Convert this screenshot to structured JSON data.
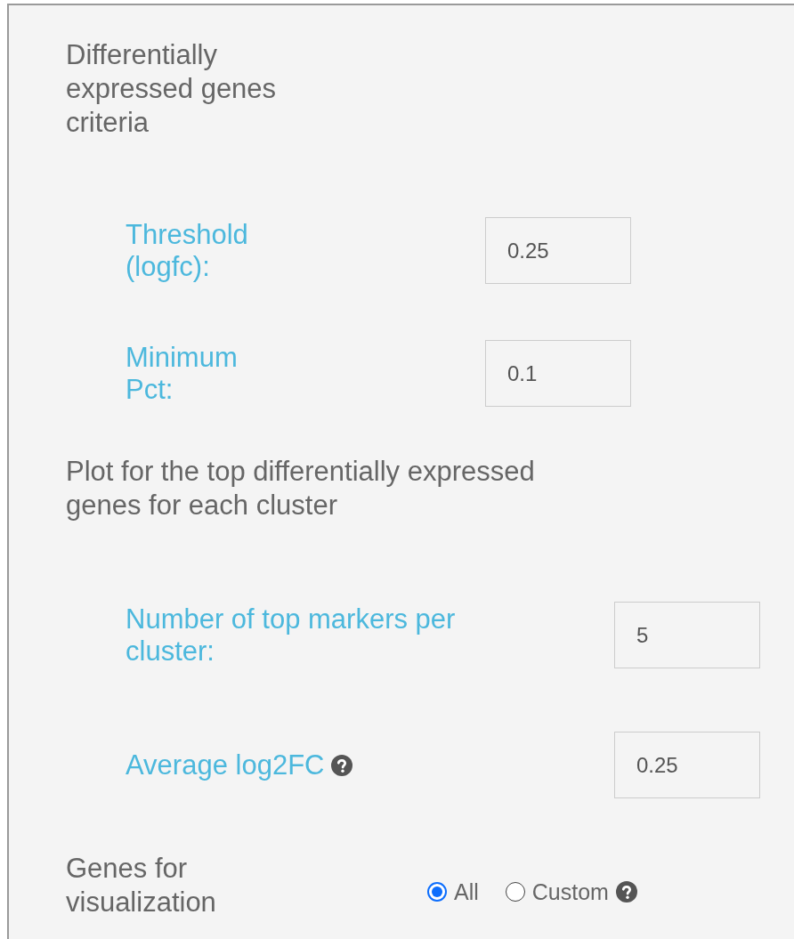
{
  "sections": [
    {
      "heading": "Differentially expressed genes criteria",
      "fields": [
        {
          "label": "Threshold (logfc):",
          "value": "0.25",
          "help": false
        },
        {
          "label": "Minimum Pct:",
          "value": "0.1",
          "help": false
        }
      ]
    },
    {
      "heading": "Plot for the top differentially expressed genes for each cluster",
      "fields": [
        {
          "label": "Number of top markers per cluster:",
          "value": "5",
          "help": false
        },
        {
          "label": "Average log2FC",
          "value": "0.25",
          "help": true
        }
      ]
    }
  ],
  "genes": {
    "label": "Genes for visualization",
    "options": [
      {
        "label": "All",
        "selected": true,
        "help": false
      },
      {
        "label": "Custom",
        "selected": false,
        "help": true
      }
    ]
  }
}
